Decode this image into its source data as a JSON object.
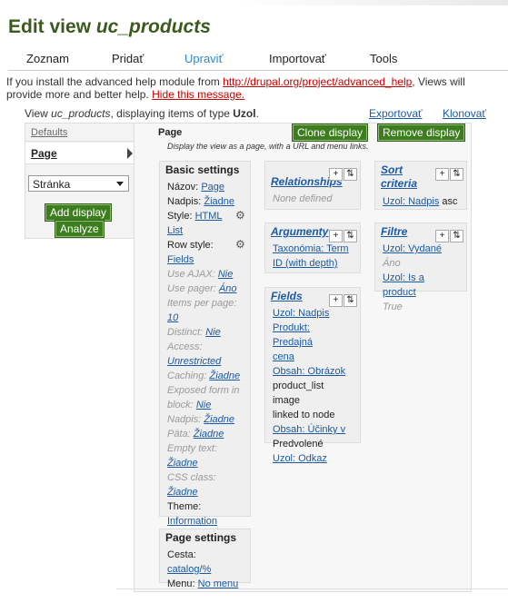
{
  "page": {
    "title_prefix": "Edit view ",
    "title_view": "uc_products"
  },
  "tabs": [
    "Zoznam",
    "Pridať",
    "Upraviť",
    "Importovať",
    "Tools"
  ],
  "help": {
    "text1": "If you install the advanced help module from ",
    "link_url": "http://drupal.org/project/advanced_help",
    "text2": ", Views will provide more and better help. ",
    "hide_link": "Hide this message."
  },
  "subheader": {
    "view_prefix": "View ",
    "view_name": "uc_products",
    "view_mid": ", displaying items of type ",
    "view_type": "Uzol",
    "view_end": ".",
    "export": "Exportovať",
    "clone": "Klonovať"
  },
  "left": {
    "defaults": "Defaults",
    "page": "Page",
    "select_value": "Stránka",
    "add_display": "Add display",
    "analyze": "Analyze"
  },
  "display": {
    "title": "Page",
    "description": "Display the view as a page, with a URL and menu links.",
    "clone_btn": "Clone display",
    "remove_btn": "Remove display"
  },
  "basic": {
    "title": "Basic settings",
    "rows": [
      {
        "label": "Názov:",
        "value": "Page",
        "dim": false
      },
      {
        "label": "Nadpis:",
        "value": "Žiadne",
        "dim": false
      },
      {
        "label": "Style:",
        "value": "HTML",
        "dim": false
      },
      {
        "label": "",
        "value": "List",
        "dim": false
      },
      {
        "label": "Row style:",
        "value": "",
        "dim": false
      },
      {
        "label": "",
        "value": "Fields",
        "dim": false
      },
      {
        "label": "Use AJAX:",
        "value": "Nie",
        "dim": true
      },
      {
        "label": "Use pager:",
        "value": "Áno",
        "dim": true
      },
      {
        "label": "Items per page:",
        "value": "",
        "dim": true
      },
      {
        "label": "",
        "value": "10",
        "dim": true
      },
      {
        "label": "Distinct:",
        "value": "Nie",
        "dim": true
      },
      {
        "label": "Access:",
        "value": "",
        "dim": true
      },
      {
        "label": "",
        "value": "Unrestricted",
        "dim": true
      },
      {
        "label": "Caching:",
        "value": "Žiadne",
        "dim": true
      },
      {
        "label": "Exposed form in",
        "value": "",
        "dim": true
      },
      {
        "label": "block:",
        "value": "Nie",
        "dim": true
      },
      {
        "label": "Nadpis:",
        "value": "Žiadne",
        "dim": true
      },
      {
        "label": "Päta:",
        "value": "Žiadne",
        "dim": true
      },
      {
        "label": "Empty text:",
        "value": "",
        "dim": true
      },
      {
        "label": "",
        "value": "Žiadne",
        "dim": true
      },
      {
        "label": "CSS class:",
        "value": "Žiadne",
        "dim": true
      },
      {
        "label": "Theme:",
        "value": "",
        "dim": false
      },
      {
        "label": "",
        "value": "Information",
        "dim": false
      }
    ]
  },
  "page_settings": {
    "title": "Page settings",
    "rows": [
      {
        "label": "Cesta:",
        "value": "catalog/%"
      },
      {
        "label": "Menu:",
        "value": "No menu"
      }
    ]
  },
  "relationships": {
    "title": "Relationships",
    "empty": "None defined"
  },
  "argumenty": {
    "title": "Argumenty",
    "lines": [
      "Taxonómia: Term",
      "ID (with depth)"
    ]
  },
  "fields": {
    "title": "Fields",
    "lines": [
      {
        "text": "Uzol: Nadpis",
        "link": true
      },
      {
        "text": "Produkt: Predajná",
        "link": true
      },
      {
        "text": "cena",
        "link": true
      },
      {
        "text": "Obsah: Obrázok",
        "link": true
      },
      {
        "text": "product_list image",
        "link": false
      },
      {
        "text": "linked to node",
        "link": false
      },
      {
        "text": "Obsah: Účinky v",
        "link": true
      },
      {
        "text": "Predvolené",
        "link": false
      },
      {
        "text": "Uzol: Odkaz",
        "link": true
      }
    ]
  },
  "sort": {
    "title1": "Sort",
    "title2": "criteria",
    "item": "Uzol: Nadpis",
    "dir": "asc"
  },
  "filtre": {
    "title": "Filtre",
    "line1": "Uzol: Vydané",
    "line1_val": "Áno",
    "line2": "Uzol: Is a product",
    "line3": "True"
  },
  "icons": {
    "plus": "+",
    "sort": "⇅",
    "gear": "⚙"
  }
}
